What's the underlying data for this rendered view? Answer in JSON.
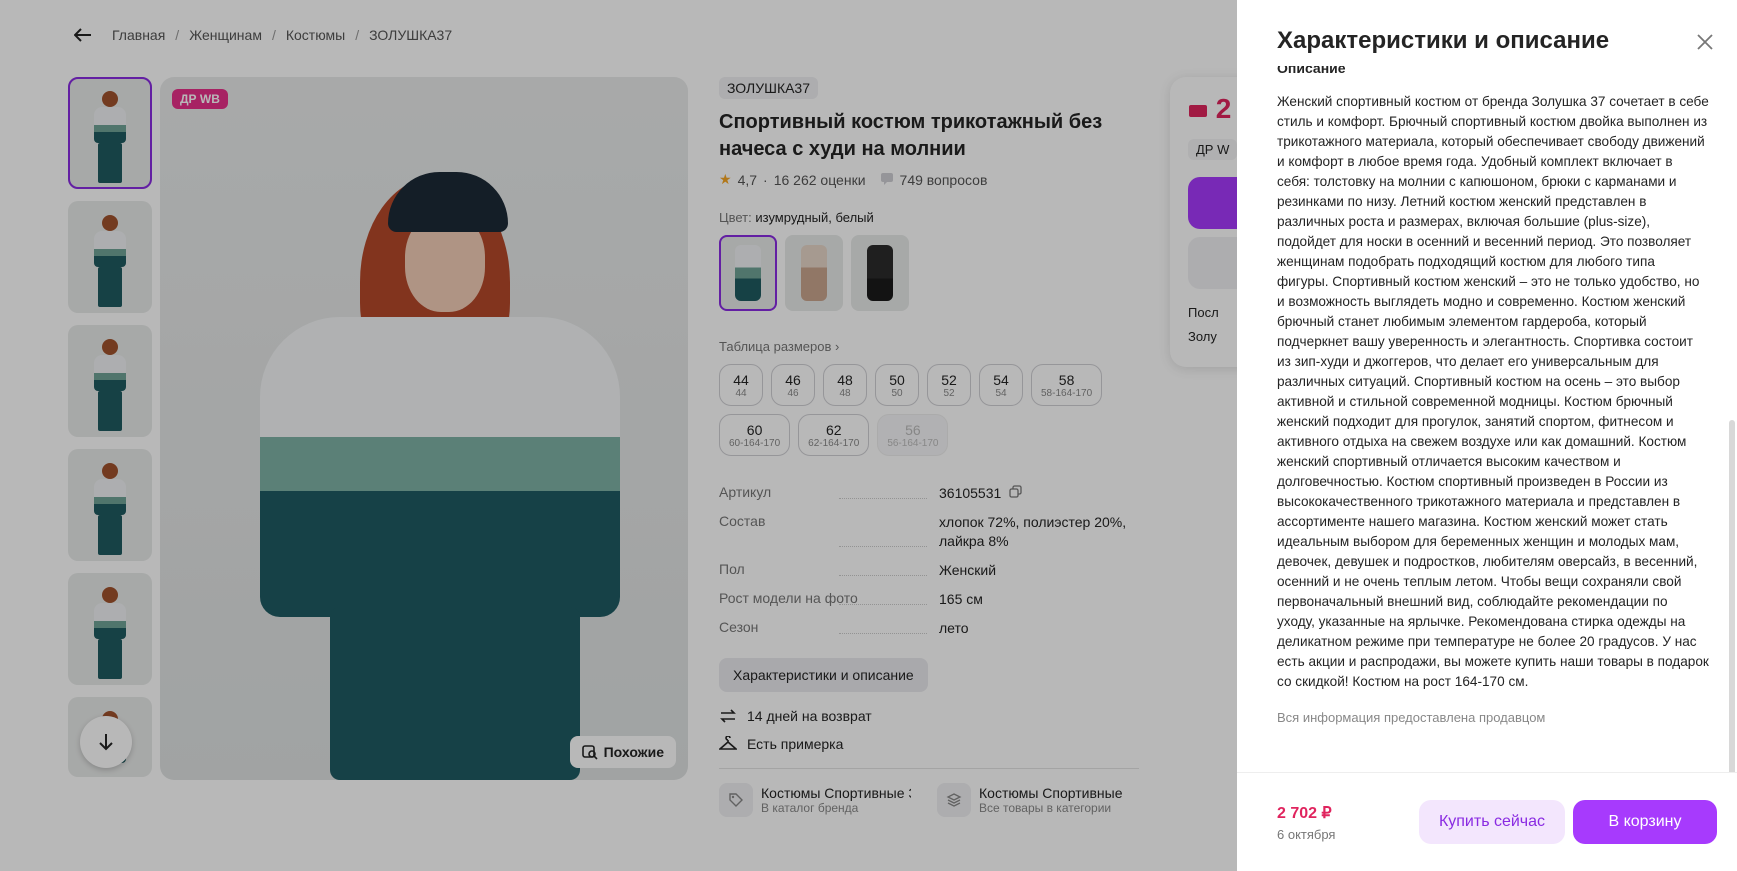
{
  "breadcrumb": [
    "Главная",
    "Женщинам",
    "Костюмы",
    "ЗОЛУШКА37"
  ],
  "main_image": {
    "badge": "ДР WB",
    "similar_label": "Похожие"
  },
  "product": {
    "brand": "ЗОЛУШКА37",
    "title": "Спортивный костюм трикотажный без начеса с худи на молнии",
    "rating": "4,7",
    "rating_sep": "·",
    "reviews": "16 262 оценки",
    "questions": "749 вопросов",
    "color_label": "Цвет:",
    "color_value": "изумрудный, белый",
    "size_table_label": "Таблица размеров",
    "sizes": [
      {
        "n": "44",
        "s": "44"
      },
      {
        "n": "46",
        "s": "46"
      },
      {
        "n": "48",
        "s": "48"
      },
      {
        "n": "50",
        "s": "50"
      },
      {
        "n": "52",
        "s": "52"
      },
      {
        "n": "54",
        "s": "54"
      },
      {
        "n": "58",
        "s": "58-164-170"
      },
      {
        "n": "60",
        "s": "60-164-170"
      },
      {
        "n": "62",
        "s": "62-164-170"
      },
      {
        "n": "56",
        "s": "56-164-170"
      }
    ],
    "specs": [
      {
        "k": "Артикул",
        "v": "36105531"
      },
      {
        "k": "Состав",
        "v": "хлопок 72%, полиэстер 20%, лайкра 8%"
      },
      {
        "k": "Пол",
        "v": "Женский"
      },
      {
        "k": "Рост модели на фото",
        "v": "165 см"
      },
      {
        "k": "Сезон",
        "v": "лето"
      }
    ],
    "char_button": "Характеристики и описание",
    "perks": [
      "14 дней на возврат",
      "Есть примерка"
    ],
    "categories": [
      {
        "title": "Костюмы Спортивные З",
        "sub": "В каталог бренда"
      },
      {
        "title": "Костюмы Спортивные",
        "sub": "Все товары в категории"
      }
    ]
  },
  "price_card": {
    "price": "2",
    "dr": "ДР W",
    "line1": "Посл",
    "line2": "Золу"
  },
  "panel": {
    "title": "Характеристики и описание",
    "section": "Описание",
    "description": "Женский спортивный костюм от бренда Золушка 37 сочетает в себе стиль и комфорт. Брючный спортивный костюм двойка выполнен из трикотажного материала, который обеспечивает свободу движений и комфорт в любое время года. Удобный комплект включает в себя: толстовку на молнии с капюшоном, брюки с карманами и резинками по низу. Летний костюм женский представлен в различных роста и размерах, включая большие (plus-size), подойдет для носки в осенний и весенний период. Это позволяет женщинам подобрать подходящий костюм для любого типа фигуры. Спортивный костюм женский – это не только удобство, но и возможность выглядеть модно и современно. Костюм женский брючный станет любимым элементом гардероба, который подчеркнет вашу уверенность и элегантность. Спортивка состоит из зип-худи и джоггеров, что делает его универсальным для различных ситуаций. Спортивный костюм на осень – это выбор активной и стильной современной модницы. Костюм брючный женский подходит для прогулок, занятий спортом, фитнесом и активного отдыха на свежем воздухе или как домашний. Костюм женский спортивный отличается высоким качеством и долговечностью. Костюм спортивный произведен в России из высококачественного трикотажного материала и представлен в ассортименте нашего магазина. Костюм женский может стать идеальным выбором для беременных женщин и молодых мам, девочек, девушек и подростков, любителям оверсайз, в весенний, осенний и не очень теплым летом. Чтобы вещи сохраняли свой первоначальный внешний вид, соблюдайте рекомендации по уходу, указанные на ярлычке. Рекомендована стирка одежды на деликатном режиме при температуре не более 20 градусов. У нас есть акции и распродажи, вы можете купить наши товары в подарок со скидкой! Костюм на рост 164-170 см.",
    "note": "Вся информация предоставлена продавцом",
    "footer": {
      "price": "2 702 ₽",
      "date": "6 октября",
      "buy_now": "Купить сейчас",
      "to_cart": "В корзину"
    }
  },
  "colors": {
    "accent": "#a73afd",
    "price": "#e0245e",
    "badge": "#e8308a"
  }
}
